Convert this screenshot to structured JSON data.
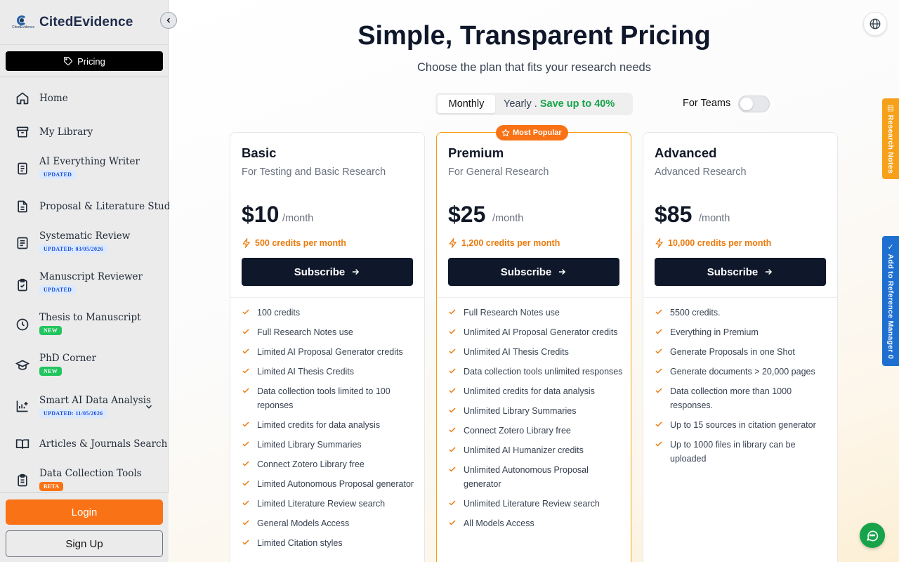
{
  "brand": {
    "name": "CitedEvidence",
    "logo_text": "CitedEvidence"
  },
  "sidebar": {
    "pricing_label": "Pricing",
    "items": [
      {
        "label": "Home",
        "icon": "home-icon"
      },
      {
        "label": "My Library",
        "icon": "archive-icon"
      },
      {
        "label": "AI Everything Writer",
        "badge": "UPDATED",
        "icon": "document-icon"
      },
      {
        "label": "Proposal & Literature Studio",
        "icon": "file-icon"
      },
      {
        "label": "Systematic Review",
        "badge": "UPDATED: 03/05/2026",
        "icon": "list-icon"
      },
      {
        "label": "Manuscript Reviewer",
        "badge": "UPDATED",
        "icon": "clipboard-check-icon"
      },
      {
        "label": "Thesis to Manuscript",
        "badge": "NEW",
        "icon": "clock-icon"
      },
      {
        "label": "PhD Corner",
        "badge": "NEW",
        "icon": "graduation-cap-icon"
      },
      {
        "label": "Smart AI Data Analysis",
        "badge": "UPDATED: 11/05/2026",
        "icon": "chart-icon"
      },
      {
        "label": "Articles & Journals Search",
        "icon": "book-open-icon"
      },
      {
        "label": "Data Collection Tools",
        "badge": "BETA",
        "icon": "clipboard-list-icon"
      }
    ],
    "login_label": "Login",
    "signup_label": "Sign Up"
  },
  "header": {
    "title": "Simple, Transparent Pricing",
    "subtitle": "Choose the plan that fits your research needs"
  },
  "billing": {
    "monthly_label": "Monthly",
    "yearly_label": "Yearly .",
    "yearly_save": "Save up to 40%",
    "teams_label": "For Teams",
    "teams_enabled": false
  },
  "plans": [
    {
      "name": "Basic",
      "description": "For Testing and Basic Research",
      "price": "$10",
      "period": "/month",
      "credits": "500 credits per month",
      "button": "Subscribe",
      "features": [
        "100 credits",
        "Full Research Notes use",
        "Limited AI Proposal Generator credits",
        "Limited AI Thesis Credits",
        "Data collection tools limited to 100 reponses",
        "Limited credits for data analysis",
        "Limited Library Summaries",
        "Connect Zotero Library free",
        "Limited Autonomous Proposal generator",
        "Limited Literature Review search",
        "General Models Access",
        "Limited Citation styles"
      ]
    },
    {
      "name": "Premium",
      "description": "For General Research",
      "price": "$25",
      "period": "/month",
      "credits": "1,200 credits per month",
      "button": "Subscribe",
      "badge": "Most Popular",
      "features": [
        "Full Research Notes use",
        "Unlimited AI Proposal Generator credits",
        "Unlimited AI Thesis Credits",
        "Data collection tools unlimited responses",
        "Unlimited credits for data analysis",
        "Unlimited Library Summaries",
        "Connect Zotero Library free",
        "Unlimited AI Humanizer credits",
        "Unlimited Autonomous Proposal generator",
        "Unlimited Literature Review search",
        "All Models Access"
      ]
    },
    {
      "name": "Advanced",
      "description": "Advanced Research",
      "price": "$85",
      "period": "/month",
      "credits": "10,000 credits per month",
      "button": "Subscribe",
      "features": [
        "5500 credits.",
        "Everything in Premium",
        "Generate Proposals in one Shot",
        "Generate documents > 20,000 pages",
        "Data collection more than 1000 responses.",
        "Up to 15 sources in citation generator",
        "Up to 1000 files in library can be uploaded"
      ]
    }
  ],
  "side_tabs": {
    "research_notes": "Research Notes",
    "reference_manager": "Add to Reference Manager",
    "reference_count": "0"
  },
  "colors": {
    "accent_orange": "#f97316",
    "dark_button": "#0f172a",
    "save_green": "#16a34a",
    "badge_blue": "#1d4ed8",
    "reference_blue": "#1f6fd1"
  }
}
